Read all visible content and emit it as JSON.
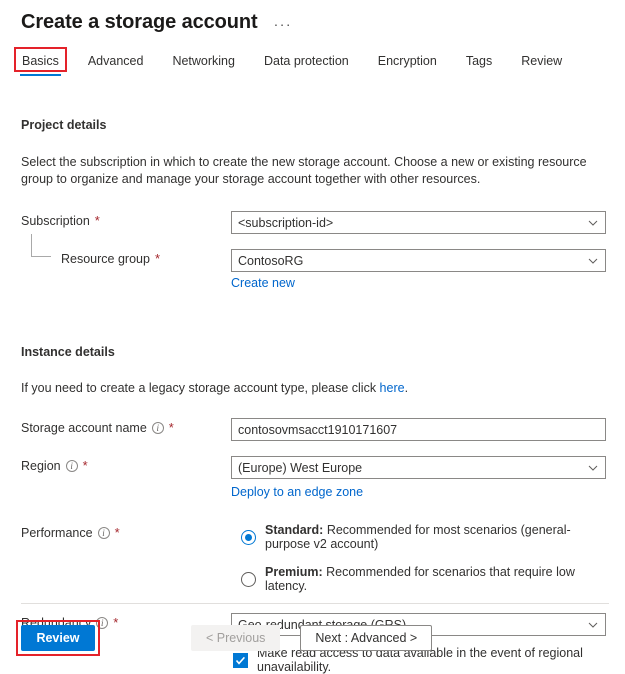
{
  "header": {
    "title": "Create a storage account",
    "more_menu": "···"
  },
  "tabs": [
    {
      "label": "Basics",
      "selected": true,
      "highlighted": true
    },
    {
      "label": "Advanced",
      "selected": false,
      "highlighted": false
    },
    {
      "label": "Networking",
      "selected": false,
      "highlighted": false
    },
    {
      "label": "Data protection",
      "selected": false,
      "highlighted": false
    },
    {
      "label": "Encryption",
      "selected": false,
      "highlighted": false
    },
    {
      "label": "Tags",
      "selected": false,
      "highlighted": false
    },
    {
      "label": "Review",
      "selected": false,
      "highlighted": false
    }
  ],
  "project_details": {
    "heading": "Project details",
    "description": "Select the subscription in which to create the new storage account. Choose a new or existing resource group to organize and manage your storage account together with other resources.",
    "subscription": {
      "label": "Subscription",
      "required": "*",
      "value": "<subscription-id>"
    },
    "resource_group": {
      "label": "Resource group",
      "required": "*",
      "value": "ContosoRG",
      "create_new_link": "Create new"
    }
  },
  "instance_details": {
    "heading": "Instance details",
    "legacy_note_before": "If you need to create a legacy storage account type, please click ",
    "legacy_note_link": "here",
    "legacy_note_after": ".",
    "storage_account_name": {
      "label": "Storage account name",
      "required": "*",
      "value": "contosovmsacct1910171607",
      "info_icon": "info-icon"
    },
    "region": {
      "label": "Region",
      "required": "*",
      "value": "(Europe) West Europe",
      "info_icon": "info-icon",
      "edge_zone_link": "Deploy to an edge zone"
    },
    "performance": {
      "label": "Performance",
      "required": "*",
      "info_icon": "info-icon",
      "options": [
        {
          "name": "Standard:",
          "description": " Recommended for most scenarios (general-purpose v2 account)",
          "selected": true
        },
        {
          "name": "Premium:",
          "description": " Recommended for scenarios that require low latency.",
          "selected": false
        }
      ]
    },
    "redundancy": {
      "label": "Redundancy",
      "required": "*",
      "info_icon": "info-icon",
      "value": "Geo-redundant storage (GRS)",
      "checkbox": {
        "label": "Make read access to data available in the event of regional unavailability.",
        "checked": true
      }
    }
  },
  "footer": {
    "review_button": "Review",
    "previous_button": "< Previous",
    "next_button": "Next : Advanced >"
  },
  "colors": {
    "accent_blue": "#0078d4",
    "link_blue": "#0066cc",
    "annotation_red": "#e4222a",
    "required_red": "#a4262c",
    "border_gray": "#8a8886",
    "text": "#323130"
  }
}
